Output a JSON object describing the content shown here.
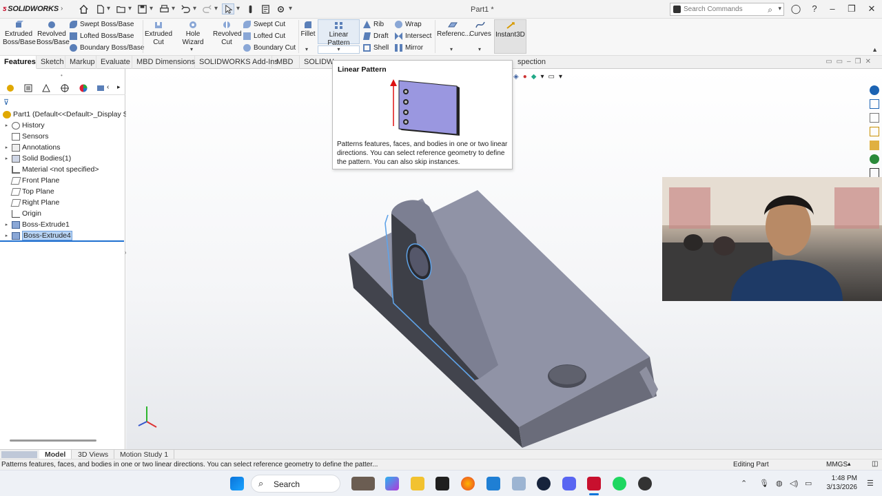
{
  "app": {
    "logo_brand": "SOLIDWORKS",
    "document_title": "Part1 *"
  },
  "search_commands": {
    "placeholder": "Search Commands"
  },
  "ribbon": {
    "extruded_boss": "Extruded Boss/Base",
    "revolved_boss": "Revolved Boss/Base",
    "swept_boss": "Swept Boss/Base",
    "lofted_boss": "Lofted Boss/Base",
    "boundary_boss": "Boundary Boss/Base",
    "extruded_cut": "Extruded Cut",
    "hole_wizard": "Hole Wizard",
    "revolved_cut": "Revolved Cut",
    "swept_cut": "Swept Cut",
    "lofted_cut": "Lofted Cut",
    "boundary_cut": "Boundary Cut",
    "fillet": "Fillet",
    "linear_pattern": "Linear Pattern",
    "rib": "Rib",
    "draft": "Draft",
    "shell": "Shell",
    "wrap": "Wrap",
    "intersect": "Intersect",
    "mirror": "Mirror",
    "reference": "Referenc...",
    "curves": "Curves",
    "instant3d": "Instant3D"
  },
  "tabs": [
    {
      "label": "Features"
    },
    {
      "label": "Sketch"
    },
    {
      "label": "Markup"
    },
    {
      "label": "Evaluate"
    },
    {
      "label": "MBD Dimensions"
    },
    {
      "label": "SOLIDWORKS Add-Ins"
    },
    {
      "label": "MBD"
    },
    {
      "label": "SOLIDW"
    },
    {
      "label": "spection"
    }
  ],
  "tooltip": {
    "title": "Linear Pattern",
    "description": "Patterns features, faces, and bodies in one or two linear directions. You can select reference geometry to define the pattern. You can also skip instances."
  },
  "tree": {
    "root": "Part1  (Default<<Default>_Display S",
    "items": [
      {
        "label": "History"
      },
      {
        "label": "Sensors"
      },
      {
        "label": "Annotations"
      },
      {
        "label": "Solid Bodies(1)"
      },
      {
        "label": "Material <not specified>"
      },
      {
        "label": "Front Plane"
      },
      {
        "label": "Top Plane"
      },
      {
        "label": "Right Plane"
      },
      {
        "label": "Origin"
      },
      {
        "label": "Boss-Extrude1"
      },
      {
        "label": "Boss-Extrude4"
      }
    ]
  },
  "bottom_tabs": [
    {
      "label": "Model"
    },
    {
      "label": "3D Views"
    },
    {
      "label": "Motion Study 1"
    }
  ],
  "status": {
    "message": "Patterns features, faces, and bodies in one or two linear directions. You can select reference geometry to define the patter...",
    "mode": "Editing Part",
    "units": "MMGS"
  },
  "taskbar": {
    "search_label": "Search",
    "time": "1:48 PM",
    "date": "3/13/2026"
  },
  "colors": {
    "accent": "#1e6fd0",
    "model_body": "#8c8fa3",
    "selection_edge": "#5fa3e8"
  }
}
